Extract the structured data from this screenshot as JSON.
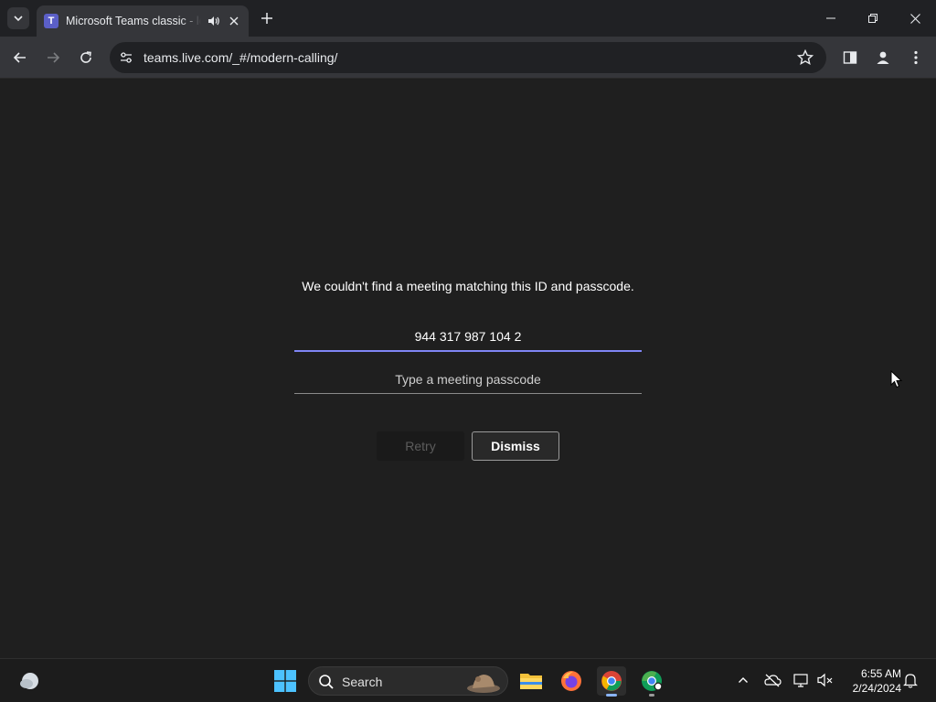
{
  "browser": {
    "tab": {
      "title": "Microsoft Teams classic - lo",
      "favicon_letter": "T",
      "favicon_color": "#5b5fc7"
    },
    "url": "teams.live.com/_#/modern-calling/"
  },
  "dialog": {
    "message": "We couldn't find a meeting matching this ID and passcode.",
    "meeting_id_value": "944 317 987 104 2",
    "passcode_placeholder": "Type a meeting passcode",
    "retry_label": "Retry",
    "dismiss_label": "Dismiss",
    "accent_color": "#7f85f5"
  },
  "taskbar": {
    "search_label": "Search",
    "apps": [
      "file-explorer",
      "firefox",
      "chrome",
      "chrome-alt"
    ],
    "time": "6:55 AM",
    "date": "2/24/2024"
  }
}
